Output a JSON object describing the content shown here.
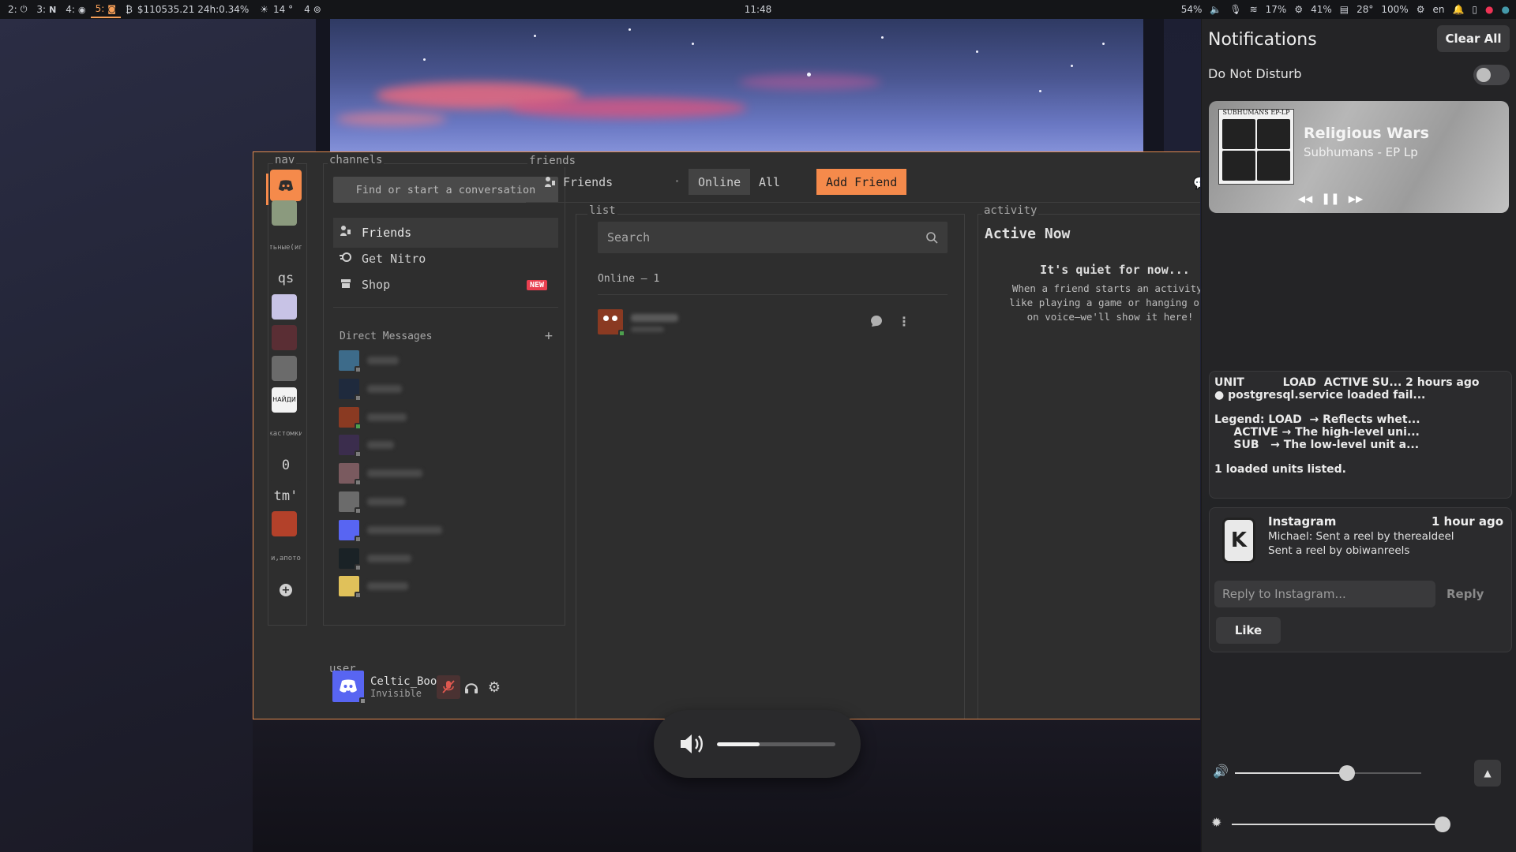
{
  "topbar": {
    "workspaces": [
      {
        "num": "2:",
        "icon": "power-icon"
      },
      {
        "num": "3:",
        "icon": "notion-icon"
      },
      {
        "num": "4:",
        "icon": "firefox-icon"
      },
      {
        "num": "5:",
        "icon": "discord-icon",
        "active": true
      }
    ],
    "btc": "$110535.21 24h:0.34%",
    "weather": "14 °",
    "updates": "4",
    "clock": "11:48",
    "volume": "54%",
    "cpu": "17%",
    "memory": "41%",
    "temp": "28°",
    "battery": "100%",
    "lang": "en"
  },
  "discord": {
    "labels": {
      "nav": "nav",
      "channels": "channels",
      "friends": "friends",
      "list": "list",
      "activity": "activity",
      "user": "user"
    },
    "nav_items": [
      {
        "kind": "discord"
      },
      {
        "kind": "image",
        "color": "#8b9a7e"
      },
      {
        "kind": "text",
        "text": "тьные(иг"
      },
      {
        "kind": "big",
        "text": "qs"
      },
      {
        "kind": "image",
        "color": "#c8c3e6"
      },
      {
        "kind": "image",
        "color": "#5a2e34"
      },
      {
        "kind": "image",
        "color": "#6b6b6b"
      },
      {
        "kind": "image",
        "color": "#f2f2f2",
        "text": "НАЙДИ"
      },
      {
        "kind": "text",
        "text": "кастомки"
      },
      {
        "kind": "big",
        "text": "0"
      },
      {
        "kind": "big",
        "text": "tm'"
      },
      {
        "kind": "image",
        "color": "#b3412a"
      },
      {
        "kind": "text",
        "text": "и,апото"
      }
    ],
    "search_placeholder": "Find or start a conversation",
    "channels": [
      {
        "label": "Friends",
        "icon": "friends-icon",
        "active": true
      },
      {
        "label": "Get Nitro",
        "icon": "nitro-icon"
      },
      {
        "label": "Shop",
        "icon": "shop-icon",
        "badge": "NEW"
      }
    ],
    "dm_header": "Direct Messages",
    "dm_add": "+",
    "dms": [
      {
        "color": "#3d6b8a",
        "status": "off",
        "w": 40
      },
      {
        "color": "#1f2a3d",
        "status": "off",
        "w": 44
      },
      {
        "color": "#8a3a22",
        "status": "on",
        "w": 50
      },
      {
        "color": "#3b2d4d",
        "status": "off",
        "w": 34
      },
      {
        "color": "#7a5a5f",
        "status": "off",
        "w": 70
      },
      {
        "color": "#6b6b6b",
        "status": "off",
        "w": 48
      },
      {
        "color": "#5865f2",
        "status": "off",
        "w": 95
      },
      {
        "color": "#1a2226",
        "status": "off",
        "w": 56
      },
      {
        "color": "#e0c15a",
        "status": "off",
        "w": 52
      }
    ],
    "user": {
      "name": "Celtic_Boozer",
      "status": "Invisible"
    },
    "tabs": {
      "friends": "Friends",
      "online": "Online",
      "all": "All",
      "add_friend": "Add Friend"
    },
    "list_search_placeholder": "Search",
    "online_header": "Online — 1",
    "activity": {
      "title": "Active Now",
      "quiet": "It's quiet for now...",
      "desc_lines": [
        "When a friend starts an activity—",
        "like playing a game or hanging out",
        "on voice—we'll show it here!"
      ]
    }
  },
  "notifications": {
    "title": "Notifications",
    "clear_all": "Clear All",
    "dnd_label": "Do Not Disturb",
    "dnd_on": false,
    "media": {
      "album_label": "SUBHUMANS EP-LP",
      "title": "Religious Wars",
      "artist": "Subhumans - EP Lp"
    },
    "systemd": {
      "lines": [
        "UNIT          LOAD  ACTIVE SU... 2 hours ago",
        "● postgresql.service loaded fail...",
        "",
        "Legend: LOAD  → Reflects whet...",
        "     ACTIVE → The high-level uni...",
        "     SUB   → The low-level unit a...",
        "",
        "1 loaded units listed."
      ]
    },
    "instagram": {
      "app": "Instagram",
      "time": "1 hour ago",
      "line1": "Michael: Sent a reel by therealdeel",
      "line2": "Sent a reel by obiwanreels",
      "reply_placeholder": "Reply to Instagram...",
      "reply_button": "Reply",
      "like_button": "Like"
    },
    "volume_level": 0.6,
    "brightness_level": 0.98
  },
  "osd": {
    "volume_level": 0.36
  }
}
